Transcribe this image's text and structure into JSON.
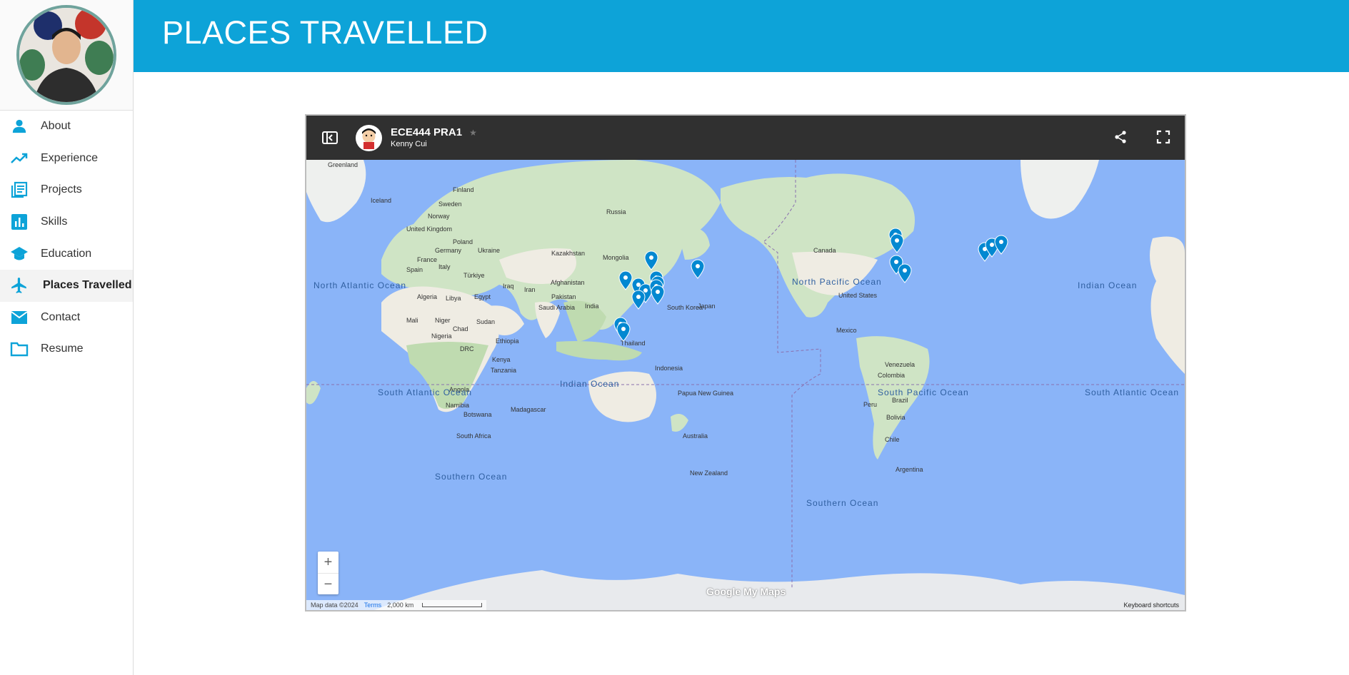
{
  "page": {
    "title": "PLACES TRAVELLED"
  },
  "sidebar": {
    "items": [
      {
        "label": "About",
        "icon": "person-icon"
      },
      {
        "label": "Experience",
        "icon": "trending-up-icon"
      },
      {
        "label": "Projects",
        "icon": "article-icon"
      },
      {
        "label": "Skills",
        "icon": "bar-chart-icon"
      },
      {
        "label": "Education",
        "icon": "school-icon"
      },
      {
        "label": "Places Travelled",
        "icon": "airplane-icon",
        "active": true
      },
      {
        "label": "Contact",
        "icon": "mail-icon"
      },
      {
        "label": "Resume",
        "icon": "folder-icon"
      }
    ]
  },
  "map": {
    "title": "ECE444 PRA1",
    "owner": "Kenny Cui",
    "brand": "Google My Maps",
    "attribution": "Map data ©2024",
    "terms": "Terms",
    "scale": "2,000 km",
    "keyboard": "Keyboard shortcuts",
    "zoom_in": "+",
    "zoom_out": "−",
    "place_labels": [
      "Greenland",
      "Iceland",
      "Finland",
      "Sweden",
      "Norway",
      "Russia",
      "United Kingdom",
      "Poland",
      "Germany",
      "Ukraine",
      "France",
      "Spain",
      "Italy",
      "Kazakhstan",
      "Mongolia",
      "Türkiye",
      "Afghanistan",
      "Iraq",
      "Iran",
      "Pakistan",
      "Saudi Arabia",
      "India",
      "Algeria",
      "Libya",
      "Egypt",
      "Mali",
      "Niger",
      "Chad",
      "Sudan",
      "Nigeria",
      "Ethiopia",
      "DRC",
      "Kenya",
      "Tanzania",
      "Angola",
      "Namibia",
      "Botswana",
      "Madagascar",
      "South Africa",
      "Thailand",
      "Indonesia",
      "Papua New Guinea",
      "Australia",
      "New Zealand",
      "South Korea",
      "Japan",
      "Canada",
      "United States",
      "Mexico",
      "Colombia",
      "Venezuela",
      "Peru",
      "Brazil",
      "Bolivia",
      "Chile",
      "Argentina"
    ],
    "ocean_labels": [
      "North Atlantic Ocean",
      "North Pacific Ocean",
      "Indian Ocean",
      "South Atlantic Ocean",
      "South Pacific Ocean",
      "Southern Ocean"
    ],
    "pin_count": 22,
    "pin_color": "#0288d1"
  }
}
